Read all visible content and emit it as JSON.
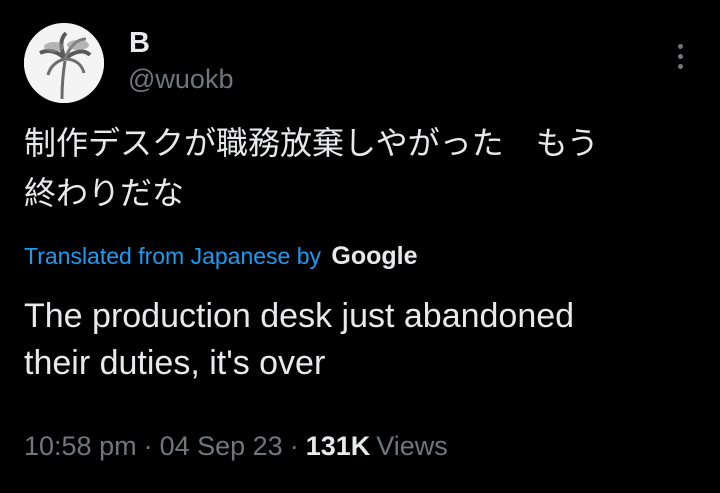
{
  "author": {
    "display_name": "B",
    "handle": "@wuokb",
    "avatar_icon": "palm-tree-avatar"
  },
  "tweet": {
    "original_line1": "制作デスクが職務放棄しやがった　もう",
    "original_line2": "終わりだな",
    "translated_from": "Translated from Japanese by",
    "translator": "Google",
    "translated_line1": "The production desk just abandoned",
    "translated_line2": "their duties, it's over"
  },
  "meta": {
    "time": "10:58 pm",
    "separator": "·",
    "date": "04 Sep 23",
    "views_count": "131K",
    "views_label": "Views"
  },
  "colors": {
    "background": "#000000",
    "text_primary": "#e7e9ea",
    "text_secondary": "#71767b",
    "link": "#1d9bf0"
  },
  "icons": {
    "more": "more-options-icon"
  }
}
